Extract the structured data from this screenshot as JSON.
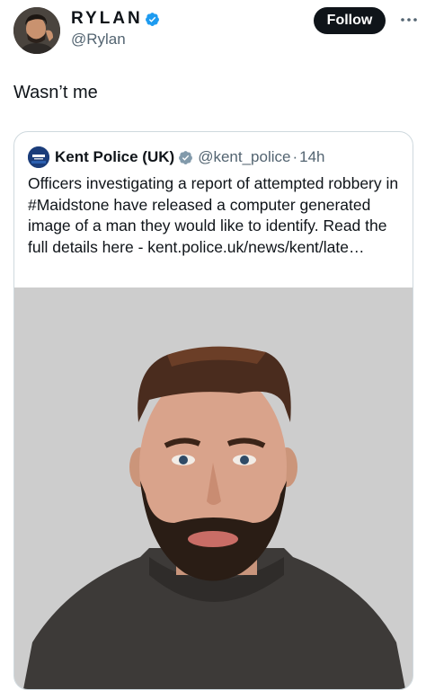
{
  "author": {
    "display_name": "RYLAN",
    "handle": "@Rylan",
    "verified_icon": "verified-badge-icon",
    "avatar_icon": "user-avatar"
  },
  "follow_label": "Follow",
  "more_icon": "more-dots-icon",
  "tweet_text": "Wasn’t me",
  "quote": {
    "display_name": "Kent Police (UK)",
    "handle": "@kent_police",
    "separator": "·",
    "time": "14h",
    "verified_icon": "gray-verified-badge-icon",
    "avatar_icon": "kent-police-logo",
    "text": "Officers investigating a report of attempted robbery in #Maidstone have released a computer generated image of a man they would like to identify. Read the full details here - kent.police.uk/news/kent/late…",
    "image_icon": "computer-generated-face-image"
  },
  "colors": {
    "text": "#0f1419",
    "secondary": "#536471",
    "verified_blue": "#1d9bf0",
    "verified_gray": "#829aab",
    "border": "#cfd9de"
  }
}
